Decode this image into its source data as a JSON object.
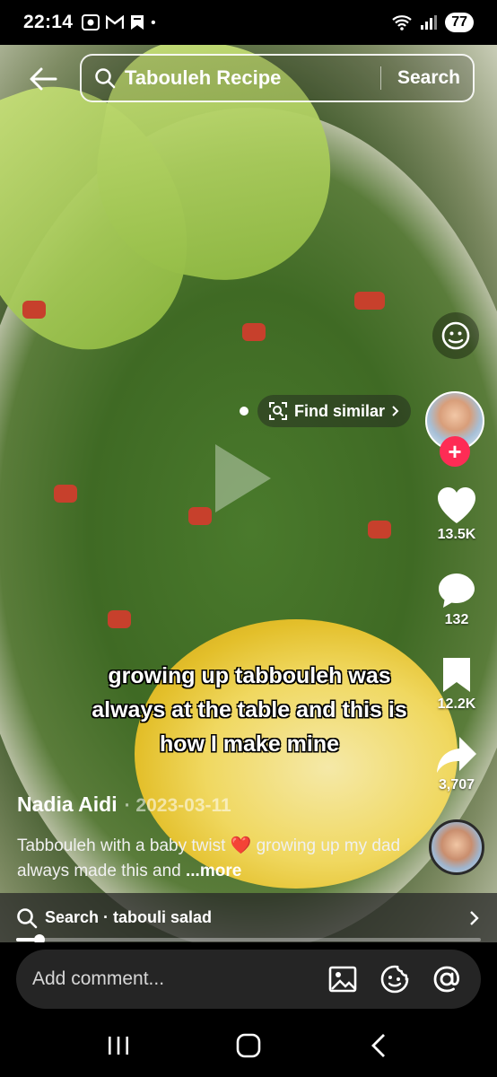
{
  "status_bar": {
    "time": "22:14",
    "left_icons": [
      "screenshot-icon",
      "gmail-icon",
      "bookmark-icon",
      "dot-icon"
    ],
    "battery": "77"
  },
  "search": {
    "query": "Tabouleh Recipe",
    "button_label": "Search"
  },
  "video": {
    "find_similar_label": "Find similar",
    "overlay_caption": "growing up tabbouleh was always at the table and this is how I make mine"
  },
  "right_rail": {
    "likes": "13.5K",
    "comments": "132",
    "saves": "12.2K",
    "shares": "3,707"
  },
  "post": {
    "author": "Nadia Aidi",
    "date": "· 2023-03-11",
    "description": "Tabbouleh with a baby twist ❤️ growing up my dad always made this and ",
    "more_label": "...more"
  },
  "related_search": {
    "label": "Search · tabouli salad"
  },
  "playback": {
    "progress_fraction": 0.05
  },
  "comment_bar": {
    "placeholder": "Add comment..."
  },
  "colors": {
    "follow_accent": "#fe2c55",
    "like_heart": "#ffffff"
  }
}
